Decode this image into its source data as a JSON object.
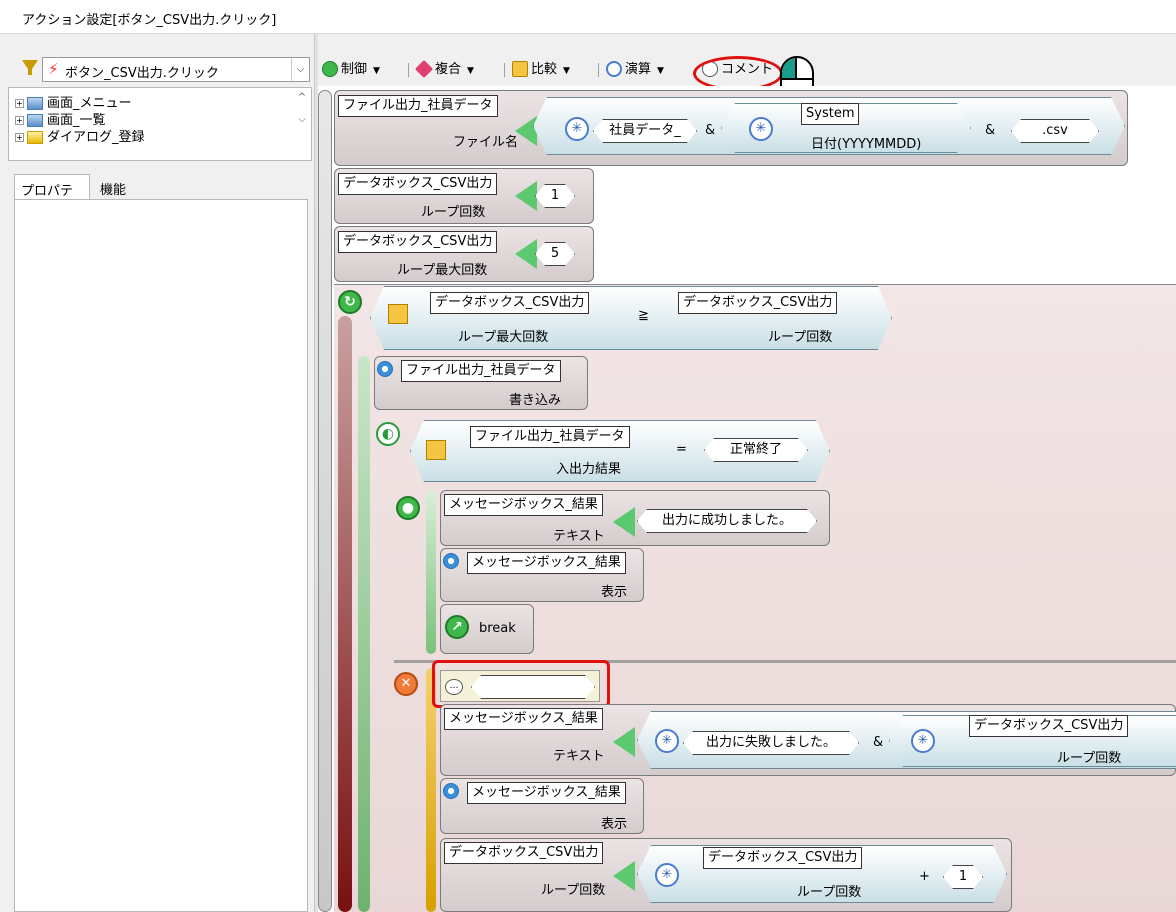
{
  "window": {
    "title": "アクション設定[ボタン_CSV出力.クリック]"
  },
  "left": {
    "event_select": "ボタン_CSV出力.クリック",
    "tree": [
      {
        "label": "画面_メニュー",
        "icon": "screen-icon"
      },
      {
        "label": "画面_一覧",
        "icon": "screen-icon"
      },
      {
        "label": "ダイアログ_登録",
        "icon": "dialog-icon"
      }
    ],
    "tabs": [
      "プロパティ",
      "機能"
    ]
  },
  "toolbar": {
    "control": "制御",
    "compound": "複合",
    "compare": "比較",
    "calc": "演算",
    "comment": "コメント"
  },
  "blocks": {
    "file_output": "ファイル出力_社員データ",
    "file_name": "ファイル名",
    "employee_data": "社員データ_",
    "amp": "&",
    "system": "System",
    "date_fmt": "日付(YYYYMMDD)",
    "csv_ext": ".csv",
    "databox_csv": "データボックス_CSV出力",
    "loop_count": "ループ回数",
    "val_1": "1",
    "loop_max": "ループ最大回数",
    "val_5": "5",
    "gte": "≧",
    "write": "書き込み",
    "io_result": "入出力結果",
    "eq": "=",
    "normal_end": "正常終了",
    "msgbox_result": "メッセージボックス_結果",
    "text": "テキスト",
    "success_msg": "出力に成功しました。",
    "show": "表示",
    "break": "break",
    "fail_msg": "出力に失敗しました。",
    "plus": "+"
  }
}
